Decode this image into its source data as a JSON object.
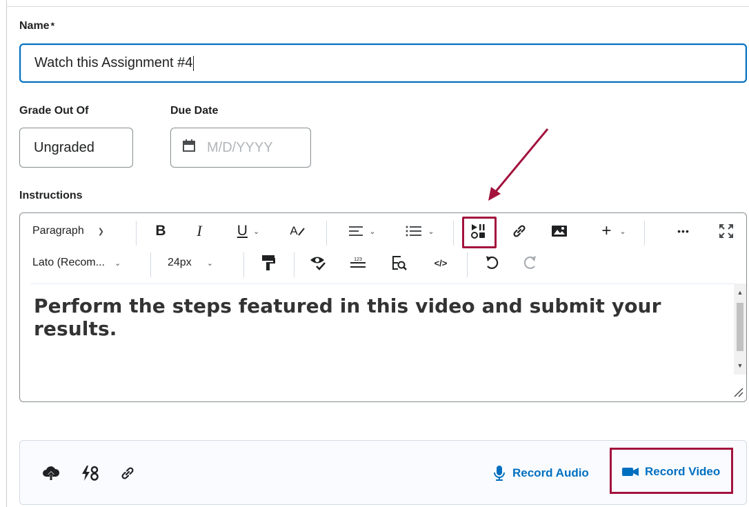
{
  "name_field": {
    "label": "Name",
    "required_marker": "*",
    "value": "Watch this Assignment #4"
  },
  "grade_field": {
    "label": "Grade Out Of",
    "value": "Ungraded"
  },
  "due_date_field": {
    "label": "Due Date",
    "placeholder": "M/D/YYYY",
    "icon": "calendar-icon"
  },
  "instructions": {
    "label": "Instructions",
    "toolbar_row1": {
      "block_format": "Paragraph",
      "bold": "B",
      "italic": "I",
      "underline": "U",
      "text_color": "A",
      "align": "align-icon",
      "list": "list-icon",
      "insert_media": "insert-media-icon",
      "insert_link": "link-icon",
      "insert_image": "image-icon",
      "insert_more": "+",
      "more_options": "•••",
      "fullscreen": "fullscreen-icon"
    },
    "toolbar_row2": {
      "font_family": "Lato (Recom...",
      "font_size": "24px",
      "format_painter": "format-painter-icon",
      "accessibility_checker": "accessibility-checker-icon",
      "word_count": "word-count-icon",
      "find_replace": "find-replace-icon",
      "source_code": "</>",
      "undo": "undo-icon",
      "redo": "redo-icon"
    },
    "content": "Perform the steps featured in this video and submit your results."
  },
  "attachments": {
    "icons": [
      "upload-icon",
      "google-drive-icon",
      "link-icon"
    ],
    "record_audio": "Record Audio",
    "record_video": "Record Video"
  },
  "colors": {
    "accent": "#006fbf",
    "highlight": "#a3123d",
    "text": "#202122",
    "border": "#868c8f"
  }
}
